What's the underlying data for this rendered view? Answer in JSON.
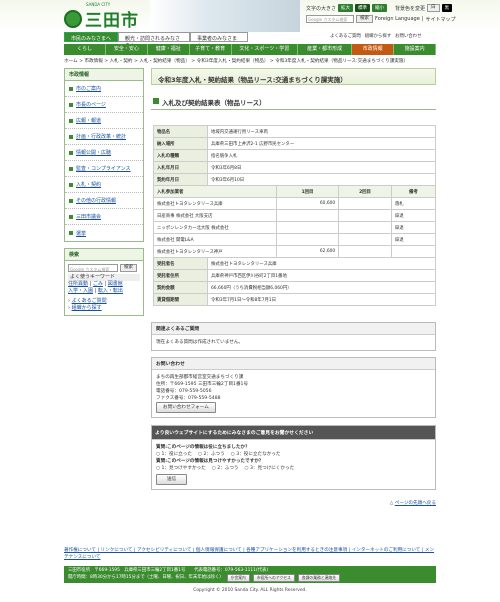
{
  "header": {
    "logo_text": "三田市",
    "logo_sub": "SANDA CITY",
    "font_size_label": "文字の大きさ",
    "font_small": "拡大",
    "font_mid": "標準",
    "font_large": "縮小",
    "bg_label": "背景色を変更",
    "bg_white": "白",
    "bg_black": "黒",
    "search_placeholder": "Google カスタム検索",
    "search_btn": "検索",
    "foreign": "Foreign Language",
    "sitemap": "サイトマップ"
  },
  "audience": {
    "citizens": "市民のみなさまへ",
    "tourists": "観光・訪問されるみなさまへ",
    "business": "事業者のみなさまへ"
  },
  "quick": {
    "faq": "よくあるご質問",
    "sitemap": "組織から探す",
    "contact": "お問い合わせ"
  },
  "nav": [
    "くらし",
    "安全・安心",
    "健康・福祉",
    "子育て・教育",
    "文化・スポーツ・学習",
    "産業・都市形成",
    "市政情報",
    "施設案内"
  ],
  "breadcrumb": "ホーム > 市政情報 > 入札・契約 > 入札・契約結果（物品） > 令和3年度入札・契約結果（物品） > 令和3年度入札・契約結果（物品リース:交通まちづくり課実施）",
  "side": {
    "heading": "市政情報",
    "items": [
      "市のご案内",
      "市長のページ",
      "広報・報道",
      "計画・行政改革・統計",
      "情報公開・広聴",
      "監査・コンプライアンス",
      "入札・契約",
      "その他の行政情報",
      "三田市議会",
      "選挙"
    ],
    "search_heading": "検索",
    "search_placeholder": "Google カスタム検索",
    "keyword": "よく使うキーワード",
    "kw1": "住所異動",
    "kw2": "ごみ",
    "kw3": "図書館",
    "kw4": "入学・入園",
    "kw5": "転入・転出",
    "faq": "よくあるご質問",
    "org": "組織から探す"
  },
  "page": {
    "title": "令和3年度入札・契約結果（物品リース:交通まちづくり課実施）",
    "section": "入札及び契約結果表（物品リース）"
  },
  "table": {
    "rows": [
      [
        "物品名",
        "地域内交通運行用リース車両"
      ],
      [
        "納入場所",
        "兵庫県三田市上井沢2-1 広野市民センター"
      ],
      [
        "入札の種類",
        "指名競争入札"
      ],
      [
        "入札年月日",
        "令和3年6月8日"
      ],
      [
        "契約年月日",
        "令和3年6月10日"
      ]
    ],
    "bid_header": [
      "入札参加業者",
      "1回目",
      "2回目",
      "備考"
    ],
    "bids": [
      [
        "株式会社トヨタレンタリース兵庫",
        "60,600",
        "",
        "落札"
      ],
      [
        "日産商事 株式会社 大阪支店",
        "",
        "",
        "辞退"
      ],
      [
        "ニッポンレンタカー北大阪 株式会社",
        "",
        "",
        "辞退"
      ],
      [
        "株式会社 関電L&A",
        "",
        "",
        "辞退"
      ],
      [
        "株式会社トヨタレンタリース神戸",
        "62,600",
        "",
        ""
      ]
    ],
    "tail": [
      [
        "受託者名",
        "株式会社トヨタレンタリース兵庫"
      ],
      [
        "受託者住所",
        "兵庫県神戸市西区伊川谷町2丁目1番地"
      ],
      [
        "契約金額",
        "66,660円（うち消費税相当額6,060円）"
      ],
      [
        "賃貸借期間",
        "令和3年7月1日～令和8年7月1日"
      ]
    ]
  },
  "faqbox": {
    "heading": "関連よくあるご質問",
    "body": "現在よくある質問は作成されていません。"
  },
  "contact": {
    "heading": "お問い合わせ",
    "line1": "まちの再生部都市経営室交通まちづくり課",
    "line2": "住所：〒669-1595 三田市三輪2丁目1番1号",
    "line3": "電話番号：079-559-5056",
    "line4": "ファクス番号：079-559-5488",
    "button": "お問い合わせフォーム"
  },
  "feedback": {
    "heading": "より良いウェブサイトにするためにみなさまのご意見をお聞かせください",
    "q1": "質問:このページの情報は役に立ちましたか？",
    "q1o": [
      "1：役に立った",
      "2：ふつう",
      "3：役に立たなかった"
    ],
    "q2": "質問:このページの情報は見つけやすかったですか？",
    "q2o": [
      "1：見つけやすかった",
      "2：ふつう",
      "3：見つけにくかった"
    ],
    "submit": "送信"
  },
  "pagetop": "ページの先頭へ戻る",
  "footer_links": "著作権について | リンクについて | アクセシビリティについて | 個人情報保護について | 各種アプリケーションを利用するときの注意事項 | インターネットのご利用について | メンテナンスについて",
  "footer": {
    "l1": "三田市役所　〒669-1595　兵庫県三田市三輪2丁目1番1号　　代表電話番号：079-563-1111(代表)",
    "l2": "開庁時間：8時30分から17時15分まで（土曜、日曜、祝日、年末年始は除く）",
    "b1": "庁舎案内",
    "b2": "市役所へのアクセス",
    "b3": "各課の業務と連絡先"
  },
  "copyright": "Copyright © 2010 Sanda City. ALL Rights Reserved."
}
